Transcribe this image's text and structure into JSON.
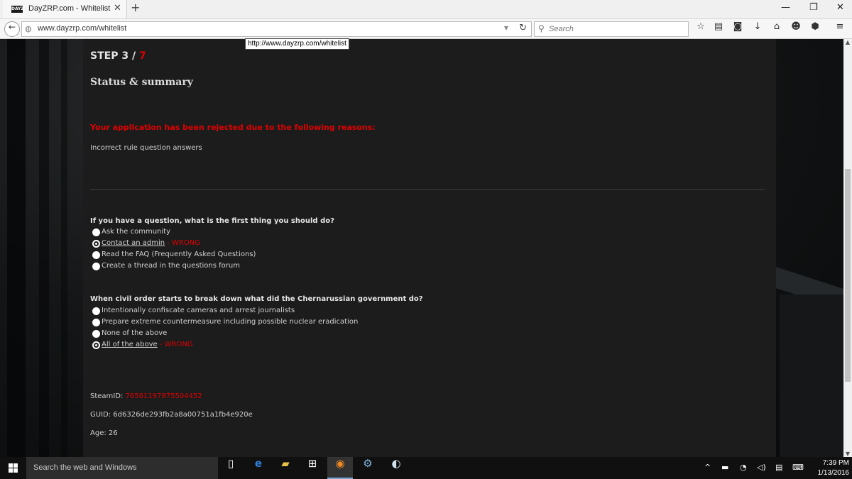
{
  "browser": {
    "tab_title": "DayZRP.com - Whitelist",
    "tab_favicon_text": "DAYZ",
    "url": "www.dayzrp.com/whitelist",
    "search_placeholder": "Search",
    "link_tooltip": "http://www.dayzrp.com/whitelist"
  },
  "page": {
    "step_label": "STEP 3 /",
    "step_total": "7",
    "heading": "Status & summary",
    "rejection_message": "Your application has been rejected due to the following reasons:",
    "rejection_reason": "Incorrect rule question answers",
    "questions": [
      {
        "question": "If you have a question, what is the first thing you should do?",
        "options": [
          {
            "label": "Ask the community",
            "selected": false,
            "marker": ""
          },
          {
            "label": "Contact an admin",
            "selected": true,
            "marker": " - WRONG"
          },
          {
            "label": "Read the FAQ (Frequently Asked Questions)",
            "selected": false,
            "marker": ""
          },
          {
            "label": "Create a thread in the questions forum",
            "selected": false,
            "marker": ""
          }
        ]
      },
      {
        "question": "When civil order starts to break down what did the Chernarussian government do?",
        "options": [
          {
            "label": "Intentionally confiscate cameras and arrest journalists",
            "selected": false,
            "marker": ""
          },
          {
            "label": "Prepare extreme countermeasure including possible nuclear eradication",
            "selected": false,
            "marker": ""
          },
          {
            "label": "None of the above",
            "selected": false,
            "marker": ""
          },
          {
            "label": "All of the above",
            "selected": true,
            "marker": " - WRONG"
          }
        ]
      }
    ],
    "steamid_label": "SteamID:",
    "steamid_value": "76561197975504452",
    "guid_label": "GUID:",
    "guid_value": "6d6326de293fb2a8a00751a1fb4e920e",
    "age_label": "Age:",
    "age_value": "26"
  },
  "taskbar": {
    "search_placeholder": "Search the web and Windows",
    "time": "7:39 PM",
    "date": "1/13/2016"
  },
  "colors": {
    "error_red": "#e00000",
    "panel_bg": "#1c1c1c"
  }
}
